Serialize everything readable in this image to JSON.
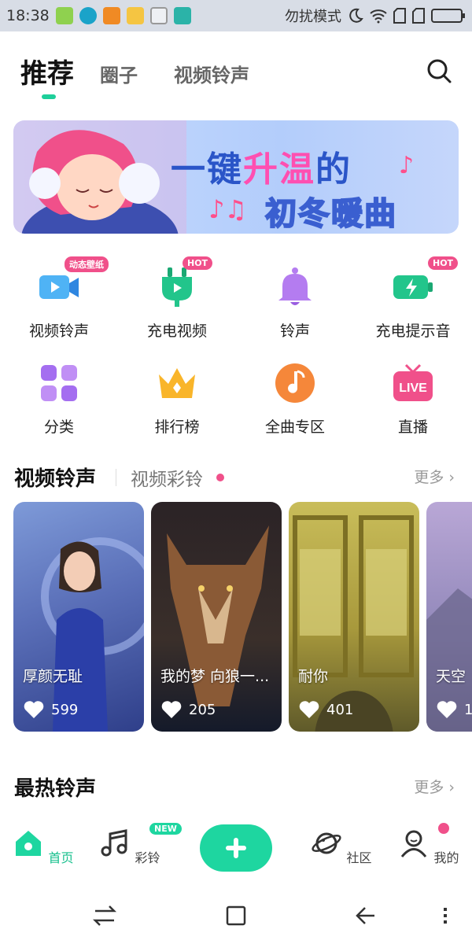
{
  "status_bar": {
    "time": "18:38",
    "dnd_text": "勿扰模式"
  },
  "top_tabs": {
    "active": "推荐",
    "tab2": "圈子",
    "tab3": "视频铃声"
  },
  "banner": {
    "line1_a": "一键",
    "line1_b": "升温",
    "line1_c": "的",
    "line2": "初冬暖曲"
  },
  "quick_grid": [
    {
      "label": "视频铃声",
      "badge": "动态壁纸",
      "icon": "video-camera-icon"
    },
    {
      "label": "充电视频",
      "badge": "HOT",
      "icon": "charging-plug-icon"
    },
    {
      "label": "铃声",
      "badge": "",
      "icon": "bell-icon"
    },
    {
      "label": "充电提示音",
      "badge": "HOT",
      "icon": "battery-bolt-icon"
    },
    {
      "label": "分类",
      "badge": "",
      "icon": "category-grid-icon"
    },
    {
      "label": "排行榜",
      "badge": "",
      "icon": "crown-icon"
    },
    {
      "label": "全曲专区",
      "badge": "",
      "icon": "music-note-icon"
    },
    {
      "label": "直播",
      "badge": "",
      "icon": "live-tv-icon"
    }
  ],
  "video_section": {
    "title": "视频铃声",
    "subtitle": "视频彩铃",
    "more": "更多 ›"
  },
  "video_cards": [
    {
      "title": "厚颜无耻",
      "likes": "599"
    },
    {
      "title": "我的梦  向狼一...",
      "likes": "205"
    },
    {
      "title": "耐你",
      "likes": "401"
    },
    {
      "title": "天空",
      "likes": "1"
    }
  ],
  "hot_section": {
    "title": "最热铃声",
    "more": "更多 ›"
  },
  "bottom_nav": {
    "home": "首页",
    "ringtone": "彩铃",
    "new_badge": "NEW",
    "community": "社区",
    "mine": "我的"
  },
  "colors": {
    "accent": "#1ed6a0",
    "badge_pink": "#f0508a"
  }
}
